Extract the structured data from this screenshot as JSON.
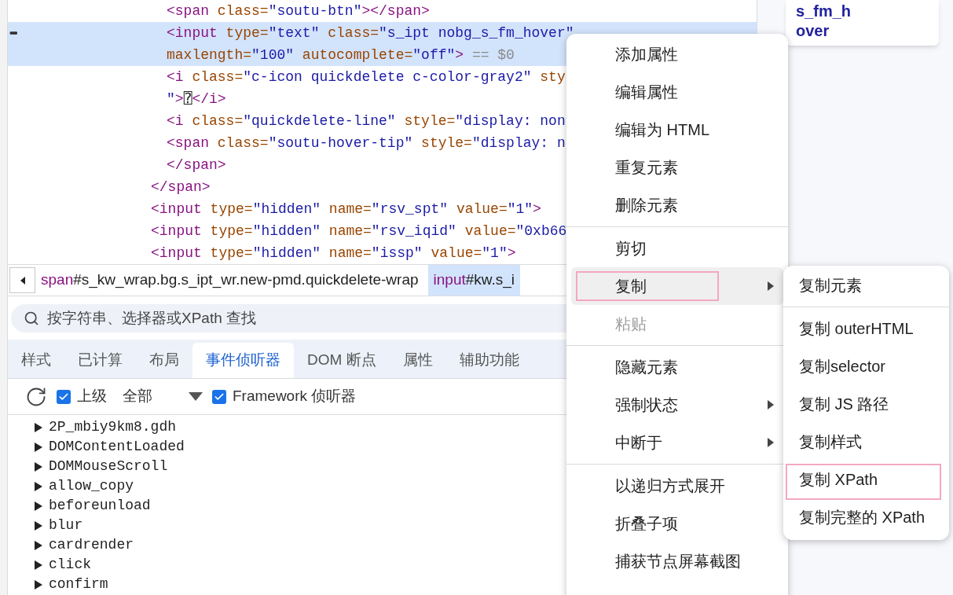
{
  "dom_tree": [
    {
      "children": [
        {
          "selected": false,
          "tokens": [
            {
              "kind": "tag",
              "text": "<span"
            },
            {
              "kind": "attr",
              "text": " class="
            },
            {
              "kind": "value",
              "text": "\"soutu-btn\""
            },
            {
              "kind": "tag",
              "text": "></span>"
            }
          ]
        },
        {
          "selected": true,
          "gutter": "•••",
          "tokens": [
            {
              "kind": "tag",
              "text": "<input"
            },
            {
              "kind": "attr",
              "text": " type="
            },
            {
              "kind": "value",
              "text": "\"text\""
            },
            {
              "kind": "attr",
              "text": " class="
            },
            {
              "kind": "value",
              "text": "\"s_ipt nobg_s_fm_hover\""
            }
          ]
        },
        {
          "selected": true,
          "tokens": [
            {
              "kind": "attr",
              "text": "maxlength="
            },
            {
              "kind": "value",
              "text": "\"100\""
            },
            {
              "kind": "attr",
              "text": " autocomplete="
            },
            {
              "kind": "value",
              "text": "\"off\""
            },
            {
              "kind": "tag",
              "text": ">"
            },
            {
              "kind": "hint",
              "text": " == $0"
            }
          ]
        },
        {
          "selected": false,
          "tokens": [
            {
              "kind": "tag",
              "text": "<i"
            },
            {
              "kind": "attr",
              "text": " class="
            },
            {
              "kind": "value",
              "text": "\"c-icon quickdelete c-color-gray2\""
            },
            {
              "kind": "attr",
              "text": " sty"
            }
          ]
        },
        {
          "selected": false,
          "tokens": [
            {
              "kind": "value",
              "text": "\""
            },
            {
              "kind": "tag",
              "text": ">"
            },
            {
              "kind": "text",
              "text": "⍰"
            },
            {
              "kind": "tag",
              "text": "</i>"
            }
          ]
        },
        {
          "selected": false,
          "tokens": [
            {
              "kind": "tag",
              "text": "<i"
            },
            {
              "kind": "attr",
              "text": " class="
            },
            {
              "kind": "value",
              "text": "\"quickdelete-line\""
            },
            {
              "kind": "attr",
              "text": " style="
            },
            {
              "kind": "value",
              "text": "\"display: non"
            }
          ]
        },
        {
          "selected": false,
          "tokens": [
            {
              "kind": "tag",
              "text": "<span"
            },
            {
              "kind": "attr",
              "text": " class="
            },
            {
              "kind": "value",
              "text": "\"soutu-hover-tip\""
            },
            {
              "kind": "attr",
              "text": " style="
            },
            {
              "kind": "value",
              "text": "\"display: n"
            }
          ]
        },
        {
          "selected": false,
          "tokens": [
            {
              "kind": "tag",
              "text": "</span>"
            }
          ]
        }
      ]
    },
    {
      "selected": false,
      "tokens": [
        {
          "kind": "tag",
          "text": "</span>"
        }
      ]
    },
    {
      "selected": false,
      "tokens": [
        {
          "kind": "tag",
          "text": "<input"
        },
        {
          "kind": "attr",
          "text": " type="
        },
        {
          "kind": "value",
          "text": "\"hidden\""
        },
        {
          "kind": "attr",
          "text": " name="
        },
        {
          "kind": "value",
          "text": "\"rsv_spt\""
        },
        {
          "kind": "attr",
          "text": " value="
        },
        {
          "kind": "value",
          "text": "\"1\""
        },
        {
          "kind": "tag",
          "text": ">"
        }
      ]
    },
    {
      "selected": false,
      "tokens": [
        {
          "kind": "tag",
          "text": "<input"
        },
        {
          "kind": "attr",
          "text": " type="
        },
        {
          "kind": "value",
          "text": "\"hidden\""
        },
        {
          "kind": "attr",
          "text": " name="
        },
        {
          "kind": "value",
          "text": "\"rsv_iqid\""
        },
        {
          "kind": "attr",
          "text": " value="
        },
        {
          "kind": "value",
          "text": "\"0xb66"
        }
      ]
    },
    {
      "selected": false,
      "tokens": [
        {
          "kind": "tag",
          "text": "<input"
        },
        {
          "kind": "attr",
          "text": " type="
        },
        {
          "kind": "value",
          "text": "\"hidden\""
        },
        {
          "kind": "attr",
          "text": " name="
        },
        {
          "kind": "value",
          "text": "\"issp\""
        },
        {
          "kind": "attr",
          "text": " value="
        },
        {
          "kind": "value",
          "text": "\"1\""
        },
        {
          "kind": "tag",
          "text": ">"
        }
      ]
    }
  ],
  "breadcrumbs": [
    {
      "tag": "span",
      "rest": "#s_kw_wrap.bg.s_ipt_wr.new-pmd.quickdelete-wrap",
      "selected": false
    },
    {
      "tag": "input",
      "rest": "#kw.s_i",
      "selected": true
    }
  ],
  "search": {
    "placeholder": "按字符串、选择器或XPath 查找"
  },
  "tabs": [
    {
      "label": "样式",
      "selected": false
    },
    {
      "label": "已计算",
      "selected": false
    },
    {
      "label": "布局",
      "selected": false
    },
    {
      "label": "事件侦听器",
      "selected": true
    },
    {
      "label": "DOM 断点",
      "selected": false
    },
    {
      "label": "属性",
      "selected": false
    },
    {
      "label": "辅助功能",
      "selected": false
    }
  ],
  "toolbar": {
    "ancestors": {
      "label": "上级",
      "checked": true
    },
    "filter": "全部",
    "framework": {
      "label": "Framework 侦听器",
      "checked": true
    }
  },
  "listeners": [
    {
      "name": "2P_mbiy9km8.gdh",
      "expanded": false
    },
    {
      "name": "DOMContentLoaded",
      "expanded": false
    },
    {
      "name": "DOMMouseScroll",
      "expanded": false
    },
    {
      "name": "allow_copy",
      "expanded": false
    },
    {
      "name": "beforeunload",
      "expanded": false
    },
    {
      "name": "blur",
      "expanded": false
    },
    {
      "name": "cardrender",
      "expanded": false
    },
    {
      "name": "click",
      "expanded": false
    },
    {
      "name": "confirm",
      "expanded": false
    }
  ],
  "tooltip": {
    "lines": [
      "s_fm_h",
      "over"
    ]
  },
  "context_menu": {
    "groups": [
      [
        {
          "label": "添加属性",
          "submenu": false,
          "disabled": false,
          "selected": false,
          "annotated": false
        },
        {
          "label": "编辑属性",
          "submenu": false,
          "disabled": false,
          "selected": false,
          "annotated": false
        },
        {
          "label": "编辑为 HTML",
          "submenu": false,
          "disabled": false,
          "selected": false,
          "annotated": false
        },
        {
          "label": "重复元素",
          "submenu": false,
          "disabled": false,
          "selected": false,
          "annotated": false
        },
        {
          "label": "删除元素",
          "submenu": false,
          "disabled": false,
          "selected": false,
          "annotated": false
        }
      ],
      [
        {
          "label": "剪切",
          "submenu": false,
          "disabled": false,
          "selected": false,
          "annotated": false
        },
        {
          "label": "复制",
          "submenu": true,
          "disabled": false,
          "selected": true,
          "annotated": true
        },
        {
          "label": "粘贴",
          "submenu": false,
          "disabled": true,
          "selected": false,
          "annotated": false
        }
      ],
      [
        {
          "label": "隐藏元素",
          "submenu": false,
          "disabled": false,
          "selected": false,
          "annotated": false
        },
        {
          "label": "强制状态",
          "submenu": true,
          "disabled": false,
          "selected": false,
          "annotated": false
        },
        {
          "label": "中断于",
          "submenu": true,
          "disabled": false,
          "selected": false,
          "annotated": false
        }
      ],
      [
        {
          "label": "以递归方式展开",
          "submenu": false,
          "disabled": false,
          "selected": false,
          "annotated": false
        },
        {
          "label": "折叠子项",
          "submenu": false,
          "disabled": false,
          "selected": false,
          "annotated": false
        },
        {
          "label": "捕获节点屏幕截图",
          "submenu": false,
          "disabled": false,
          "selected": false,
          "annotated": false
        }
      ]
    ]
  },
  "submenu": {
    "groups": [
      [
        {
          "label": "复制元素",
          "annotated": false
        }
      ],
      [
        {
          "label": "复制 outerHTML",
          "annotated": false
        },
        {
          "label": "复制selector",
          "annotated": false
        },
        {
          "label": "复制 JS 路径",
          "annotated": false
        },
        {
          "label": "复制样式",
          "annotated": false
        },
        {
          "label": "复制 XPath",
          "annotated": true
        },
        {
          "label": "复制完整的 XPath",
          "annotated": false
        }
      ]
    ]
  }
}
